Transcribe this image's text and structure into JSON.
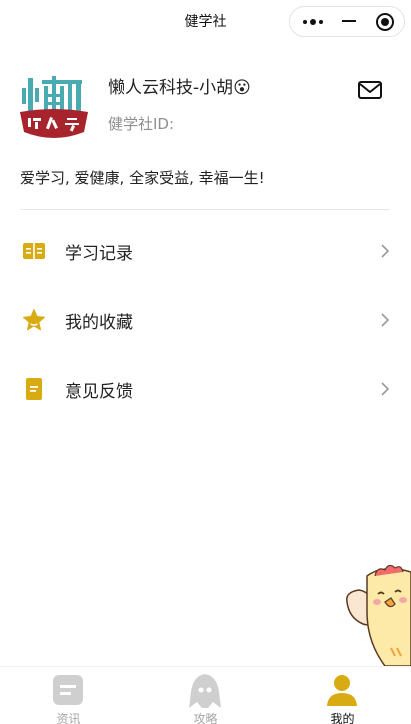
{
  "navbar": {
    "title": "健学社",
    "more_icon": "more-dots-icon",
    "minimize_icon": "minimize-icon",
    "close_icon": "target-close-icon"
  },
  "profile": {
    "avatar_logo_text": "懒人云",
    "name": "懒人云科技-小胡😮",
    "id_label": "健学社ID:",
    "mail_icon": "mail-icon"
  },
  "motto": "爱学习, 爱健康, 全家受益, 幸福一生!",
  "menu": [
    {
      "label": "学习记录",
      "icon": "open-book-icon"
    },
    {
      "label": "我的收藏",
      "icon": "star-icon"
    },
    {
      "label": "意见反馈",
      "icon": "feedback-doc-icon"
    }
  ],
  "tabbar": [
    {
      "label": "资讯",
      "icon": "news-icon",
      "active": false
    },
    {
      "label": "攻略",
      "icon": "ghost-icon",
      "active": false
    },
    {
      "label": "我的",
      "icon": "person-icon",
      "active": true
    }
  ],
  "colors": {
    "accent": "#d9ab12",
    "inactive_icon": "#cfcfcf",
    "text_primary": "#222222",
    "text_secondary": "#8f8f8f",
    "divider": "#e7e7e7",
    "logo_teal": "#4aaab2",
    "logo_red": "#a8242c"
  }
}
